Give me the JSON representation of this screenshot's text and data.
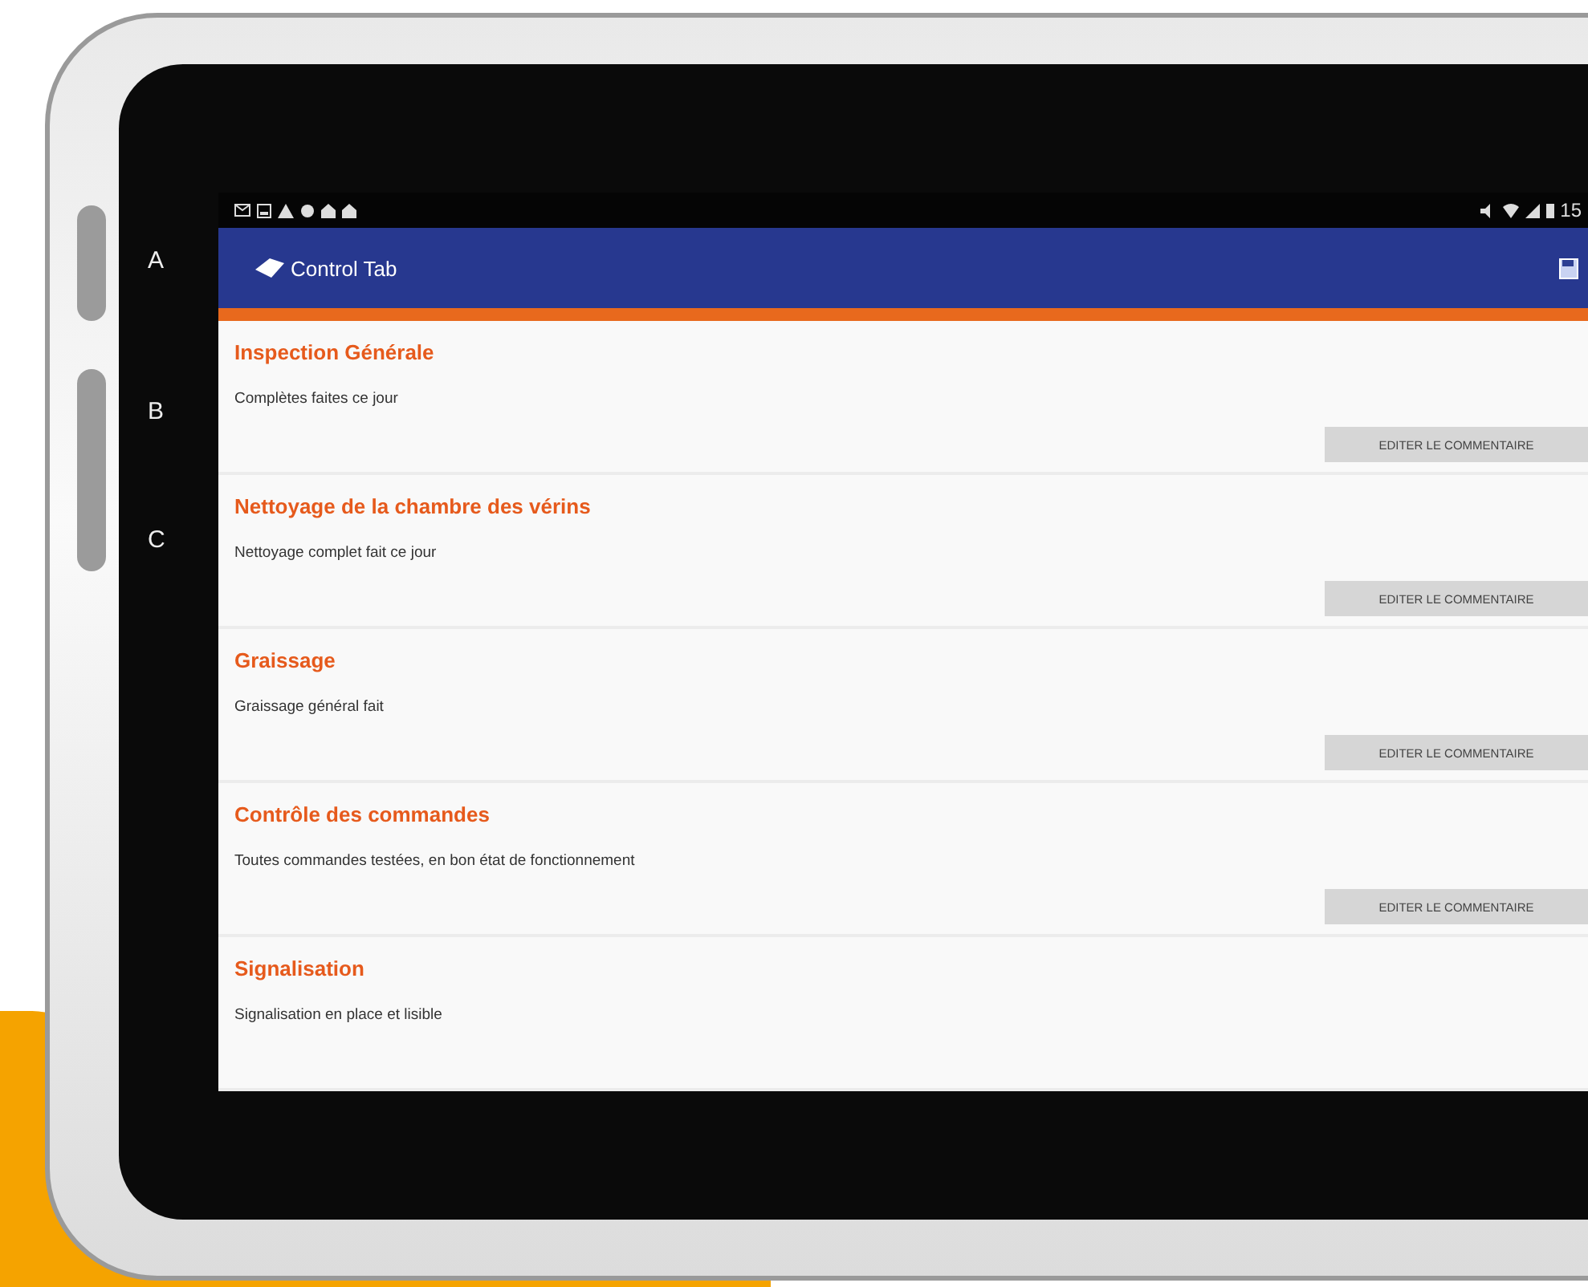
{
  "side_labels": [
    "A",
    "B",
    "C"
  ],
  "status_bar": {
    "time": "15"
  },
  "app_bar": {
    "title": "Control Tab"
  },
  "items": [
    {
      "title": "Inspection Générale",
      "comment": "Complètes faites ce jour",
      "button": "EDITER LE COMMENTAIRE"
    },
    {
      "title": "Nettoyage de la chambre des vérins",
      "comment": "Nettoyage complet fait ce jour",
      "button": "EDITER LE COMMENTAIRE"
    },
    {
      "title": "Graissage",
      "comment": "Graissage général fait",
      "button": "EDITER LE COMMENTAIRE"
    },
    {
      "title": "Contrôle des commandes",
      "comment": "Toutes commandes testées, en bon état de fonctionnement",
      "button": "EDITER LE COMMENTAIRE"
    },
    {
      "title": "Signalisation",
      "comment": "Signalisation en place et lisible"
    }
  ]
}
